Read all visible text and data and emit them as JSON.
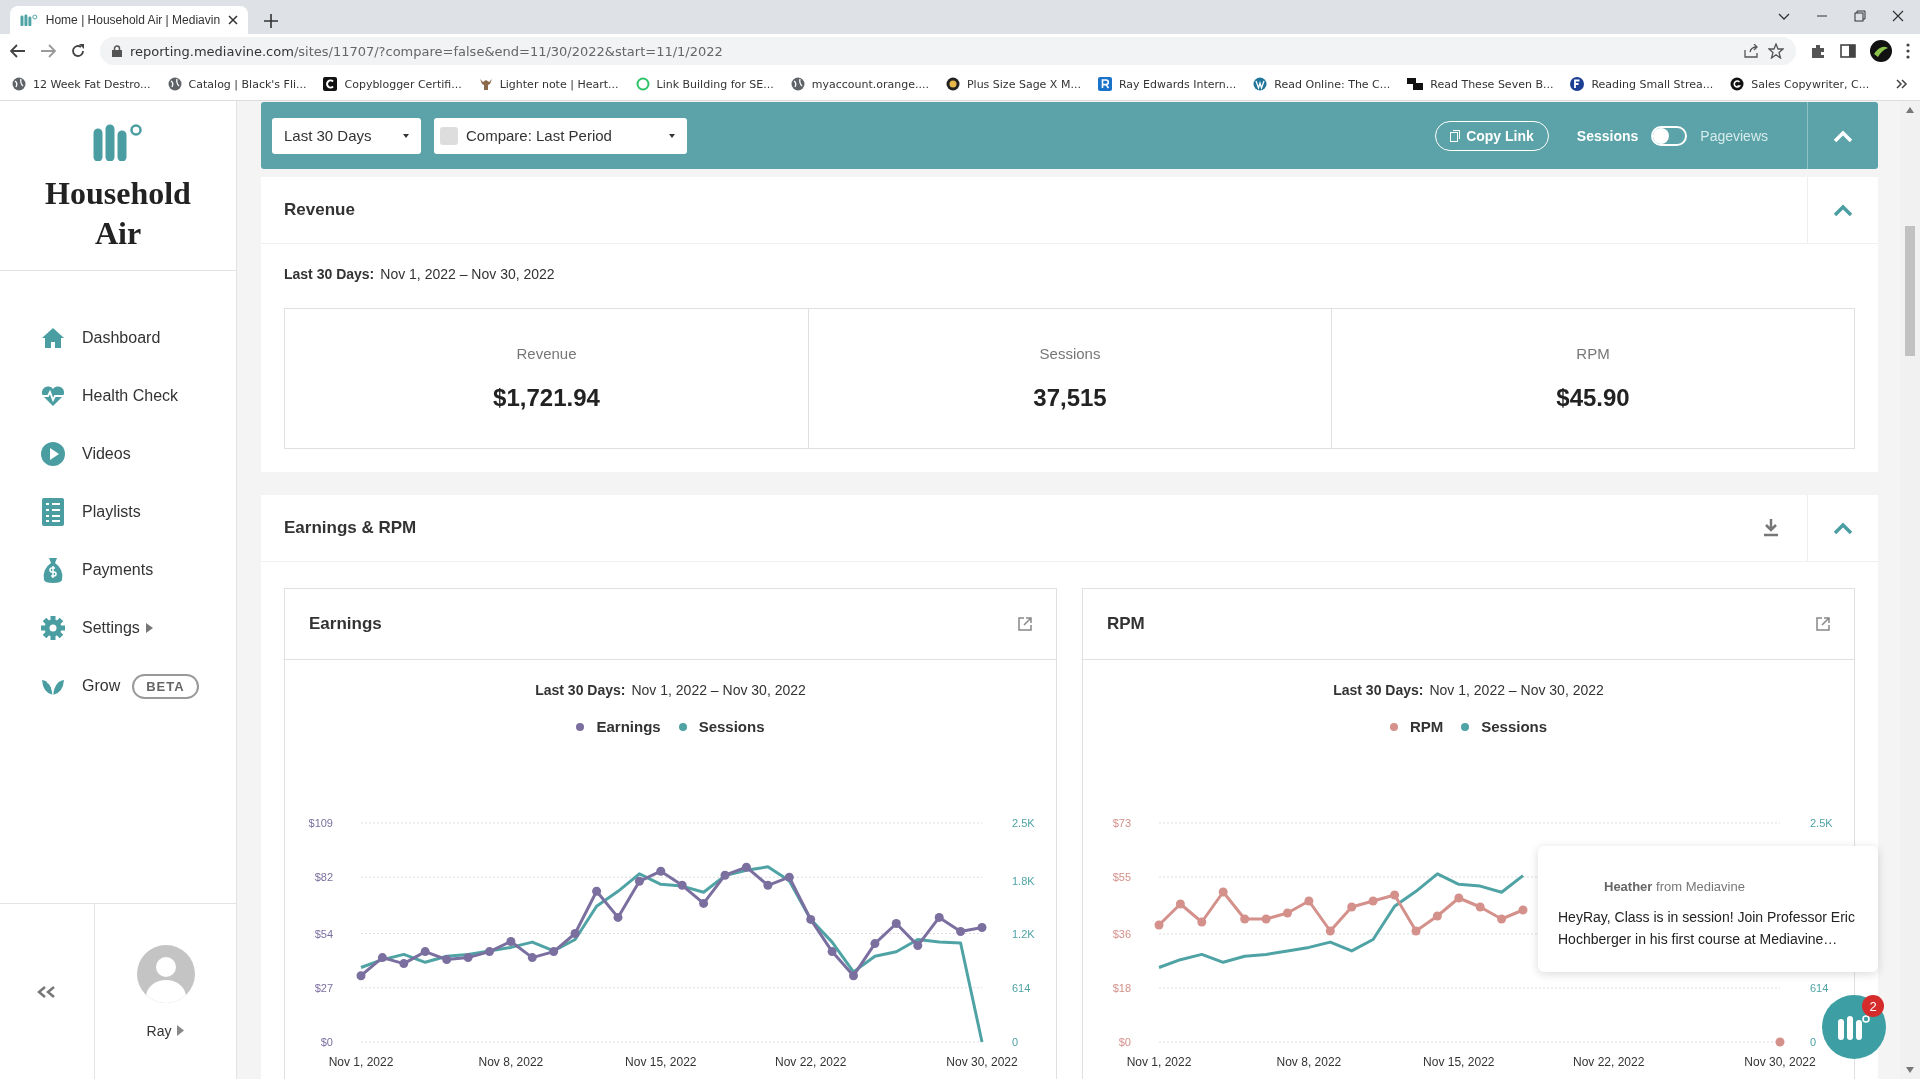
{
  "browser": {
    "tab_title": "Home | Household Air | Mediavin",
    "url_host": "reporting.mediavine.com",
    "url_path": "/sites/11707/?compare=false&end=11/30/2022&start=11/1/2022",
    "bookmarks": [
      "12 Week Fat Destro...",
      "Catalog | Black's Fli...",
      "Copyblogger Certifi...",
      "Lighter note | Heart...",
      "Link Building for SE...",
      "myaccount.orange....",
      "Plus Size Sage X M...",
      "Ray Edwards Intern...",
      "Read Online: The C...",
      "Read These Seven B...",
      "Reading Small Strea...",
      "Sales Copywriter, C..."
    ]
  },
  "sidebar": {
    "site_name": "Household Air",
    "nav": [
      {
        "label": "Dashboard",
        "has_submenu": false
      },
      {
        "label": "Health Check",
        "has_submenu": false
      },
      {
        "label": "Videos",
        "has_submenu": false
      },
      {
        "label": "Playlists",
        "has_submenu": false
      },
      {
        "label": "Payments",
        "has_submenu": false
      },
      {
        "label": "Settings",
        "has_submenu": true
      },
      {
        "label": "Grow",
        "has_submenu": false,
        "badge": "BETA"
      }
    ],
    "user": "Ray"
  },
  "toolbar": {
    "range": "Last 30 Days",
    "compare": "Compare: Last Period",
    "compare_checked": false,
    "copy_link": "Copy Link",
    "toggle_left": "Sessions",
    "toggle_right": "Pageviews",
    "toggle_on": false
  },
  "revenue": {
    "title": "Revenue",
    "period_label": "Last 30 Days:",
    "period": "Nov 1, 2022 – Nov 30, 2022",
    "metrics": [
      {
        "label": "Revenue",
        "value": "$1,721.94"
      },
      {
        "label": "Sessions",
        "value": "37,515"
      },
      {
        "label": "RPM",
        "value": "$45.90"
      }
    ]
  },
  "earnings_rpm": {
    "title": "Earnings & RPM",
    "charts": [
      {
        "title": "Earnings",
        "period_label": "Last 30 Days:",
        "period": "Nov 1, 2022 – Nov 30, 2022",
        "chart_data": {
          "type": "line",
          "categories": [
            "Nov 1, 2022",
            null,
            null,
            null,
            null,
            null,
            null,
            "Nov 8, 2022",
            null,
            null,
            null,
            null,
            null,
            null,
            "Nov 15, 2022",
            null,
            null,
            null,
            null,
            null,
            null,
            "Nov 22, 2022",
            null,
            null,
            null,
            null,
            null,
            null,
            null,
            "Nov 30, 2022"
          ],
          "grid": true,
          "ylim": [
            0,
            109
          ],
          "yticks": [
            {
              "value": 0,
              "label": "$0"
            },
            {
              "value": 27,
              "label": "$27"
            },
            {
              "value": 54,
              "label": "$54"
            },
            {
              "value": 82,
              "label": "$82"
            },
            {
              "value": 109,
              "label": "$109"
            }
          ],
          "y2lim": [
            0,
            2500
          ],
          "y2ticks": [
            {
              "value": 0,
              "label": "0"
            },
            {
              "value": 614,
              "label": "614"
            },
            {
              "value": 1228,
              "label": "1.2K"
            },
            {
              "value": 1842,
              "label": "1.8K"
            },
            {
              "value": 2500,
              "label": "2.5K"
            }
          ],
          "series": [
            {
              "name": "Earnings",
              "color": "#7b6fa0",
              "marker": true,
              "values": [
                33,
                42,
                39,
                45,
                41,
                42,
                45,
                50,
                42,
                45,
                54,
                75,
                62,
                80,
                85,
                78,
                69,
                83,
                87,
                78,
                82,
                61,
                45,
                33,
                49,
                59,
                48,
                62,
                55,
                57
              ]
            },
            {
              "name": "Sessions",
              "color": "#4fa3a5",
              "axis": "y2",
              "values": [
                850,
                940,
                1000,
                910,
                980,
                1000,
                1040,
                1080,
                1140,
                1040,
                1170,
                1550,
                1720,
                1920,
                1800,
                1780,
                1710,
                1900,
                1960,
                2000,
                1840,
                1400,
                1140,
                800,
                980,
                1030,
                1170,
                1140,
                1130,
                0
              ]
            }
          ]
        }
      },
      {
        "title": "RPM",
        "period_label": "Last 30 Days:",
        "period": "Nov 1, 2022 – Nov 30, 2022",
        "chart_data": {
          "type": "line",
          "categories": [
            "Nov 1, 2022",
            null,
            null,
            null,
            null,
            null,
            null,
            "Nov 8, 2022",
            null,
            null,
            null,
            null,
            null,
            null,
            "Nov 15, 2022",
            null,
            null,
            null,
            null,
            null,
            null,
            "Nov 22, 2022",
            null,
            null,
            null,
            null,
            null,
            null,
            null,
            "Nov 30, 2022"
          ],
          "grid": true,
          "ylim": [
            0,
            73
          ],
          "yticks": [
            {
              "value": 0,
              "label": "$0"
            },
            {
              "value": 18,
              "label": "$18"
            },
            {
              "value": 36,
              "label": "$36"
            },
            {
              "value": 55,
              "label": "$55"
            },
            {
              "value": 73,
              "label": "$73"
            }
          ],
          "y2lim": [
            0,
            2500
          ],
          "y2ticks": [
            {
              "value": 0,
              "label": "0"
            },
            {
              "value": 614,
              "label": "614"
            },
            {
              "value": 2500,
              "label": "2.5K"
            }
          ],
          "series": [
            {
              "name": "RPM",
              "color": "#d4908a",
              "marker": true,
              "values": [
                39,
                46,
                40,
                50,
                41,
                41,
                43,
                47,
                37,
                45,
                47,
                49,
                37,
                42,
                48,
                45,
                41,
                44,
                null,
                null,
                null,
                null,
                null,
                null,
                null,
                null,
                null,
                null,
                null,
                0
              ]
            },
            {
              "name": "Sessions",
              "color": "#4fa3a5",
              "axis": "y2",
              "values": [
                850,
                940,
                1000,
                910,
                980,
                1000,
                1040,
                1080,
                1140,
                1040,
                1170,
                1550,
                1720,
                1920,
                1800,
                1780,
                1710,
                1900,
                null,
                null,
                null,
                null,
                null,
                null,
                null,
                null,
                null,
                null,
                null,
                null
              ]
            }
          ]
        }
      }
    ]
  },
  "chat": {
    "sender": "Heather",
    "from": "from Mediavine",
    "message": "HeyRay, Class is in session! Join Professor Eric Hochberger in his first course at Mediavine…",
    "unread": "2"
  }
}
